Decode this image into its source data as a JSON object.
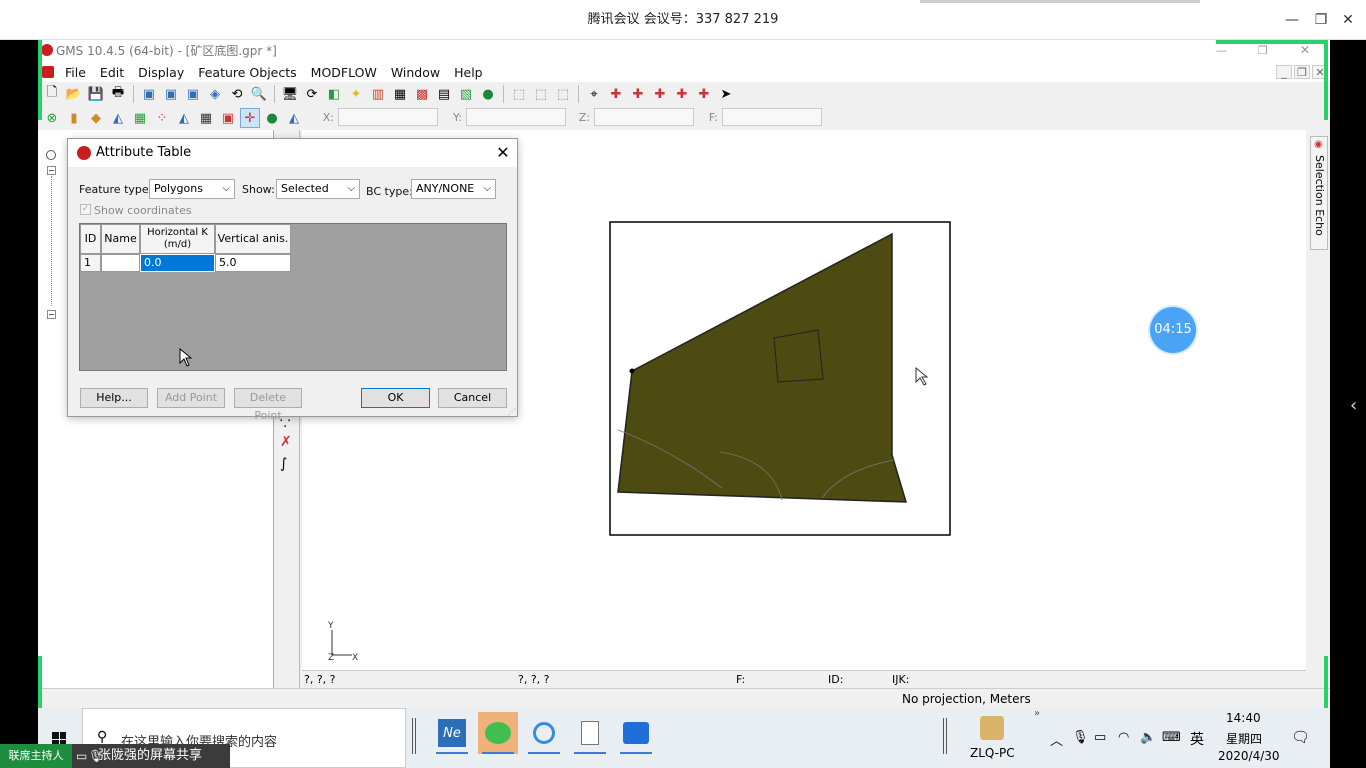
{
  "meeting": {
    "title": "腾讯会议 会议号：337 827 219",
    "timer": "04:15",
    "host_tag": "联席主持人",
    "share_label": "张陇强的屏幕共享"
  },
  "app": {
    "title": "GMS 10.4.5 (64-bit) - [矿区底图.gpr *]",
    "menu": [
      "File",
      "Edit",
      "Display",
      "Feature Objects",
      "MODFLOW",
      "Window",
      "Help"
    ],
    "coord_labels": {
      "x": "X:",
      "y": "Y:",
      "z": "Z:",
      "f": "F:"
    },
    "side_tab": "Selection Echo",
    "status1": {
      "a": "?, ?, ?",
      "b": "?, ?, ?",
      "f": "F:",
      "id": "ID:",
      "ijk": "IJK:"
    },
    "status2": "No projection, Meters",
    "axis": {
      "y": "Y",
      "z": "Z",
      "x": "X"
    }
  },
  "dialog": {
    "title": "Attribute Table",
    "feature_type_label": "Feature type:",
    "feature_type": "Polygons",
    "show_label": "Show:",
    "show": "Selected",
    "bc_label": "BC type:",
    "bc": "ANY/NONE",
    "show_coords": "Show coordinates",
    "columns": [
      "ID",
      "Name",
      "Horizontal K\n(m/d)",
      "Vertical anis."
    ],
    "row": {
      "id": "1",
      "name": "",
      "hk": "0.0",
      "va": "5.0"
    },
    "buttons": {
      "help": "Help...",
      "add": "Add Point",
      "del": "Delete Point",
      "ok": "OK",
      "cancel": "Cancel"
    }
  },
  "taskbar": {
    "search": "在这里输入你要搜索的内容",
    "pc": "ZLQ-PC",
    "ime": "英",
    "time": "14:40",
    "weekday": "星期四",
    "date": "2020/4/30"
  },
  "colors": {
    "polygon": "#4d4a12",
    "accent": "#2bd06c"
  }
}
